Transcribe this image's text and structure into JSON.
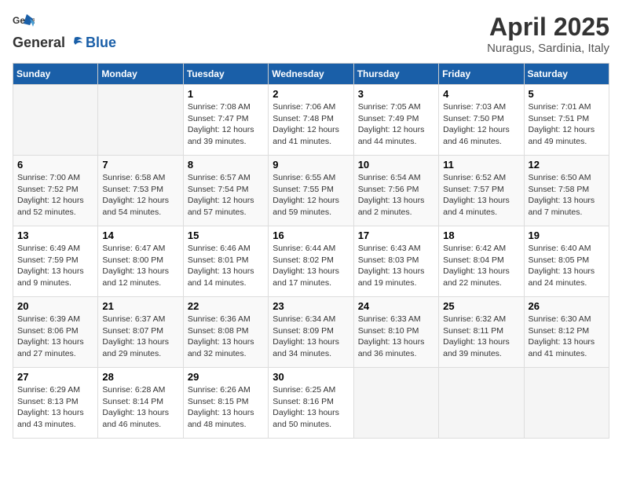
{
  "header": {
    "logo_general": "General",
    "logo_blue": "Blue",
    "title": "April 2025",
    "subtitle": "Nuragus, Sardinia, Italy"
  },
  "days_of_week": [
    "Sunday",
    "Monday",
    "Tuesday",
    "Wednesday",
    "Thursday",
    "Friday",
    "Saturday"
  ],
  "weeks": [
    [
      {
        "day": "",
        "info": ""
      },
      {
        "day": "",
        "info": ""
      },
      {
        "day": "1",
        "info": "Sunrise: 7:08 AM\nSunset: 7:47 PM\nDaylight: 12 hours\nand 39 minutes."
      },
      {
        "day": "2",
        "info": "Sunrise: 7:06 AM\nSunset: 7:48 PM\nDaylight: 12 hours\nand 41 minutes."
      },
      {
        "day": "3",
        "info": "Sunrise: 7:05 AM\nSunset: 7:49 PM\nDaylight: 12 hours\nand 44 minutes."
      },
      {
        "day": "4",
        "info": "Sunrise: 7:03 AM\nSunset: 7:50 PM\nDaylight: 12 hours\nand 46 minutes."
      },
      {
        "day": "5",
        "info": "Sunrise: 7:01 AM\nSunset: 7:51 PM\nDaylight: 12 hours\nand 49 minutes."
      }
    ],
    [
      {
        "day": "6",
        "info": "Sunrise: 7:00 AM\nSunset: 7:52 PM\nDaylight: 12 hours\nand 52 minutes."
      },
      {
        "day": "7",
        "info": "Sunrise: 6:58 AM\nSunset: 7:53 PM\nDaylight: 12 hours\nand 54 minutes."
      },
      {
        "day": "8",
        "info": "Sunrise: 6:57 AM\nSunset: 7:54 PM\nDaylight: 12 hours\nand 57 minutes."
      },
      {
        "day": "9",
        "info": "Sunrise: 6:55 AM\nSunset: 7:55 PM\nDaylight: 12 hours\nand 59 minutes."
      },
      {
        "day": "10",
        "info": "Sunrise: 6:54 AM\nSunset: 7:56 PM\nDaylight: 13 hours\nand 2 minutes."
      },
      {
        "day": "11",
        "info": "Sunrise: 6:52 AM\nSunset: 7:57 PM\nDaylight: 13 hours\nand 4 minutes."
      },
      {
        "day": "12",
        "info": "Sunrise: 6:50 AM\nSunset: 7:58 PM\nDaylight: 13 hours\nand 7 minutes."
      }
    ],
    [
      {
        "day": "13",
        "info": "Sunrise: 6:49 AM\nSunset: 7:59 PM\nDaylight: 13 hours\nand 9 minutes."
      },
      {
        "day": "14",
        "info": "Sunrise: 6:47 AM\nSunset: 8:00 PM\nDaylight: 13 hours\nand 12 minutes."
      },
      {
        "day": "15",
        "info": "Sunrise: 6:46 AM\nSunset: 8:01 PM\nDaylight: 13 hours\nand 14 minutes."
      },
      {
        "day": "16",
        "info": "Sunrise: 6:44 AM\nSunset: 8:02 PM\nDaylight: 13 hours\nand 17 minutes."
      },
      {
        "day": "17",
        "info": "Sunrise: 6:43 AM\nSunset: 8:03 PM\nDaylight: 13 hours\nand 19 minutes."
      },
      {
        "day": "18",
        "info": "Sunrise: 6:42 AM\nSunset: 8:04 PM\nDaylight: 13 hours\nand 22 minutes."
      },
      {
        "day": "19",
        "info": "Sunrise: 6:40 AM\nSunset: 8:05 PM\nDaylight: 13 hours\nand 24 minutes."
      }
    ],
    [
      {
        "day": "20",
        "info": "Sunrise: 6:39 AM\nSunset: 8:06 PM\nDaylight: 13 hours\nand 27 minutes."
      },
      {
        "day": "21",
        "info": "Sunrise: 6:37 AM\nSunset: 8:07 PM\nDaylight: 13 hours\nand 29 minutes."
      },
      {
        "day": "22",
        "info": "Sunrise: 6:36 AM\nSunset: 8:08 PM\nDaylight: 13 hours\nand 32 minutes."
      },
      {
        "day": "23",
        "info": "Sunrise: 6:34 AM\nSunset: 8:09 PM\nDaylight: 13 hours\nand 34 minutes."
      },
      {
        "day": "24",
        "info": "Sunrise: 6:33 AM\nSunset: 8:10 PM\nDaylight: 13 hours\nand 36 minutes."
      },
      {
        "day": "25",
        "info": "Sunrise: 6:32 AM\nSunset: 8:11 PM\nDaylight: 13 hours\nand 39 minutes."
      },
      {
        "day": "26",
        "info": "Sunrise: 6:30 AM\nSunset: 8:12 PM\nDaylight: 13 hours\nand 41 minutes."
      }
    ],
    [
      {
        "day": "27",
        "info": "Sunrise: 6:29 AM\nSunset: 8:13 PM\nDaylight: 13 hours\nand 43 minutes."
      },
      {
        "day": "28",
        "info": "Sunrise: 6:28 AM\nSunset: 8:14 PM\nDaylight: 13 hours\nand 46 minutes."
      },
      {
        "day": "29",
        "info": "Sunrise: 6:26 AM\nSunset: 8:15 PM\nDaylight: 13 hours\nand 48 minutes."
      },
      {
        "day": "30",
        "info": "Sunrise: 6:25 AM\nSunset: 8:16 PM\nDaylight: 13 hours\nand 50 minutes."
      },
      {
        "day": "",
        "info": ""
      },
      {
        "day": "",
        "info": ""
      },
      {
        "day": "",
        "info": ""
      }
    ]
  ]
}
